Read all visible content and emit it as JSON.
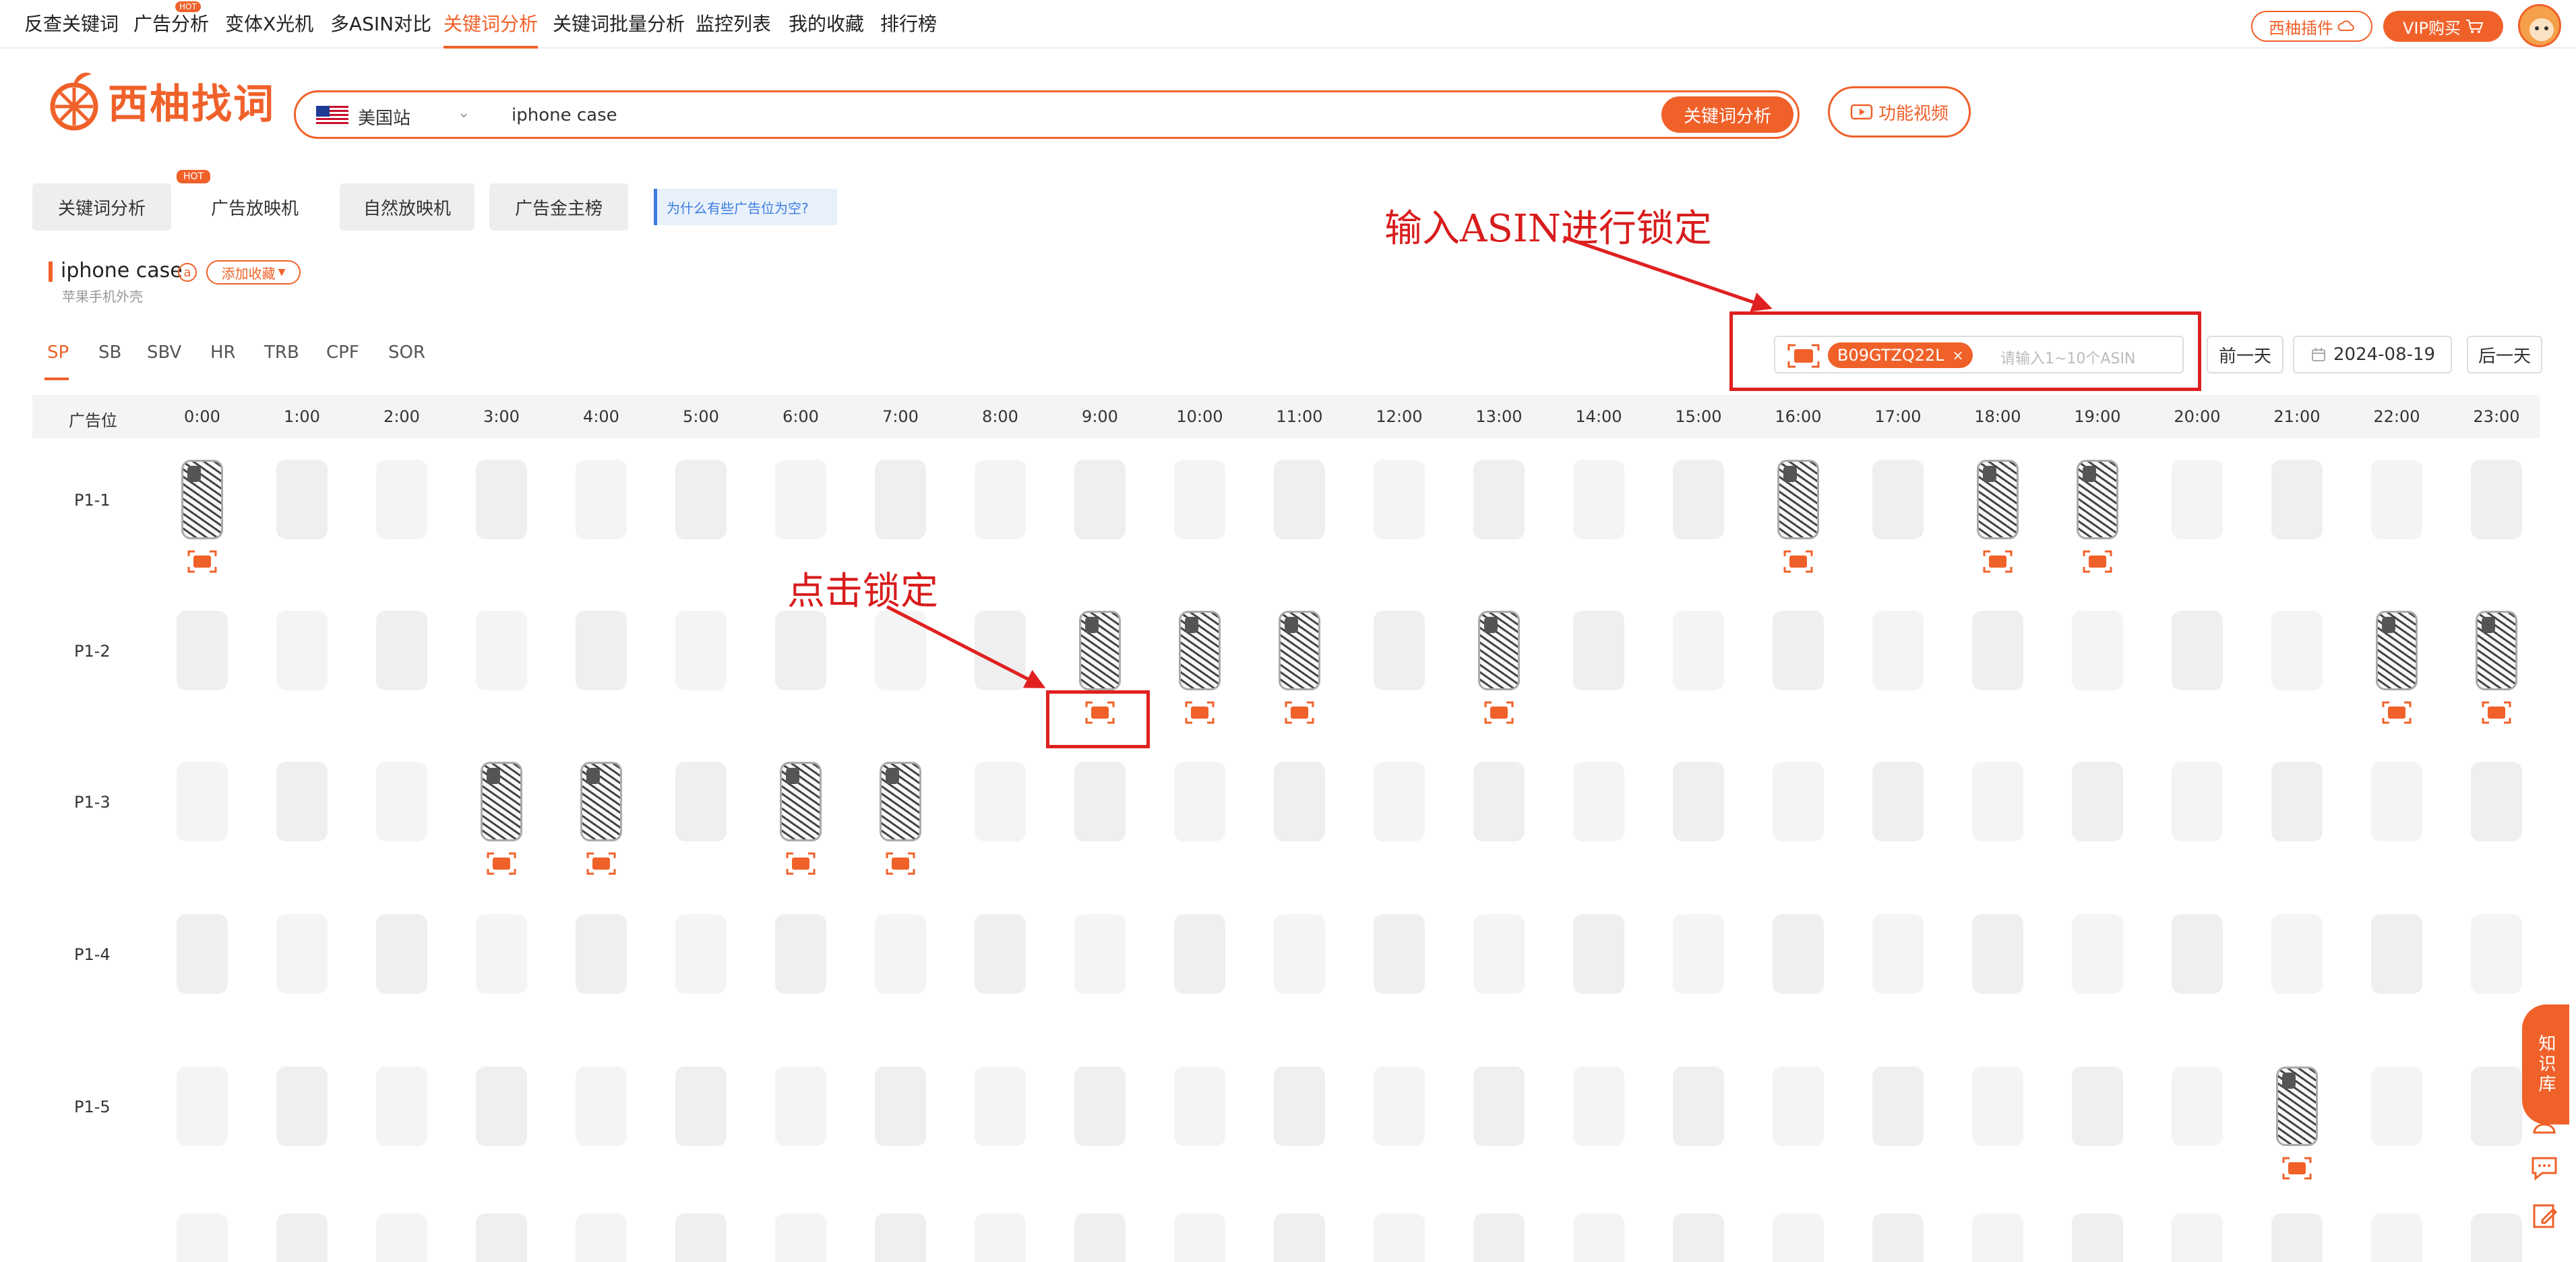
{
  "nav": {
    "items": [
      "反查关键词",
      "广告分析",
      "变体X光机",
      "多ASIN对比",
      "关键词分析",
      "关键词批量分析",
      "监控列表",
      "我的收藏",
      "排行榜"
    ],
    "active_index": 4,
    "hot_badge": "HOT",
    "plugin_label": "西柚插件",
    "vip_label": "VIP购买"
  },
  "logo": {
    "text": "西柚找词"
  },
  "search": {
    "site": "美国站",
    "keyword": "iphone case",
    "button": "关键词分析"
  },
  "video_button": "功能视频",
  "tabs": {
    "items": [
      "关键词分析",
      "广告放映机",
      "自然放映机",
      "广告金主榜"
    ],
    "active_index": 1,
    "hot_badge": "HOT",
    "help_text": "为什么有些广告位为空?"
  },
  "keyword": {
    "title": "iphone case",
    "subtitle": "苹果手机外壳",
    "a_icon": "a",
    "favorite_label": "添加收藏"
  },
  "ad_types": {
    "items": [
      "SP",
      "SB",
      "SBV",
      "HR",
      "TRB",
      "CPF",
      "SOR"
    ],
    "active_index": 0
  },
  "asin_lock": {
    "chip": "B09GTZQ22L",
    "placeholder": "请输入1~10个ASIN"
  },
  "date_nav": {
    "prev": "前一天",
    "date": "2024-08-19",
    "next": "后一天"
  },
  "grid": {
    "header_label": "广告位",
    "hours": [
      "0:00",
      "1:00",
      "2:00",
      "3:00",
      "4:00",
      "5:00",
      "6:00",
      "7:00",
      "8:00",
      "9:00",
      "10:00",
      "11:00",
      "12:00",
      "13:00",
      "14:00",
      "15:00",
      "16:00",
      "17:00",
      "18:00",
      "19:00",
      "20:00",
      "21:00",
      "22:00",
      "23:00"
    ],
    "rows": [
      "P1-1",
      "P1-2",
      "P1-3",
      "P1-4",
      "P1-5"
    ],
    "locked_slots": {
      "P1-1": [
        0,
        16,
        18,
        19
      ],
      "P1-2": [
        9,
        10,
        11,
        13,
        22,
        23
      ],
      "P1-3": [
        3,
        4,
        6,
        7
      ],
      "P1-4": [],
      "P1-5": [
        21
      ]
    }
  },
  "annotations": {
    "input_asin": "输入ASIN进行锁定",
    "click_lock": "点击锁定"
  },
  "sidebar": {
    "label": "知识库"
  },
  "colors": {
    "accent": "#f0612a",
    "annotation": "#d81c1c",
    "help_blue": "#3c7be0"
  },
  "icons": [
    "search-icon",
    "lock-target-icon",
    "calendar-icon",
    "video-icon",
    "cart-icon",
    "cloud-icon",
    "customer-service-icon",
    "chat-icon",
    "edit-icon"
  ]
}
